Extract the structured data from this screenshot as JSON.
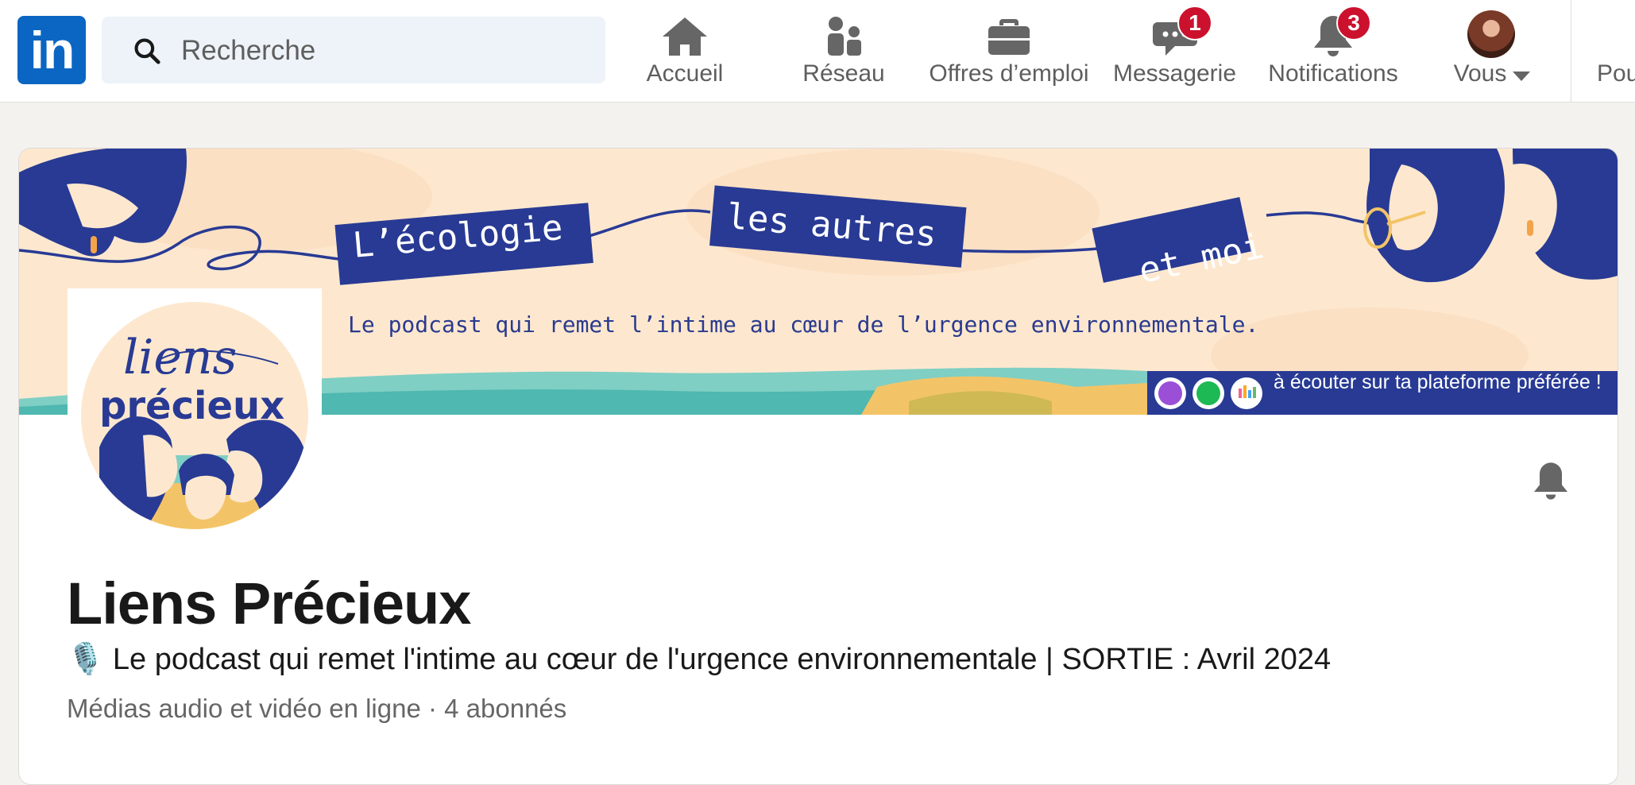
{
  "nav": {
    "logo_text": "in",
    "search_placeholder": "Recherche",
    "items": [
      {
        "label": "Accueil",
        "icon": "home-icon"
      },
      {
        "label": "Réseau",
        "icon": "network-icon"
      },
      {
        "label": "Offres d’emploi",
        "icon": "briefcase-icon"
      },
      {
        "label": "Messagerie",
        "icon": "messaging-icon",
        "badge": "1"
      },
      {
        "label": "Notifications",
        "icon": "bell-icon",
        "badge": "3"
      },
      {
        "label": "Vous",
        "icon": "avatar"
      }
    ],
    "more_label": "Pou"
  },
  "banner": {
    "word1": "L’écologie",
    "word2": "les autres",
    "word3": "et moi",
    "subtitle": "Le podcast qui remet l’intime au cœur de l’urgence environnementale.",
    "cta": "à écouter sur ta plateforme préférée !",
    "colors": {
      "cream": "#fde8cf",
      "navy": "#283a94",
      "teal": "#4fb8b0",
      "sand": "#f3c467"
    }
  },
  "logo": {
    "line1": "liens",
    "line2": "précieux"
  },
  "page": {
    "name": "Liens Précieux",
    "tagline_icon": "🎙️",
    "tagline": "Le podcast qui remet l'intime au cœur de l'urgence environnementale | SORTIE : Avril 2024",
    "meta": "Médias audio et vidéo en ligne · 4 abonnés"
  },
  "colors": {
    "brand": "#0a66c2",
    "badge": "#cb112d",
    "page_bg": "#f4f2ee"
  }
}
